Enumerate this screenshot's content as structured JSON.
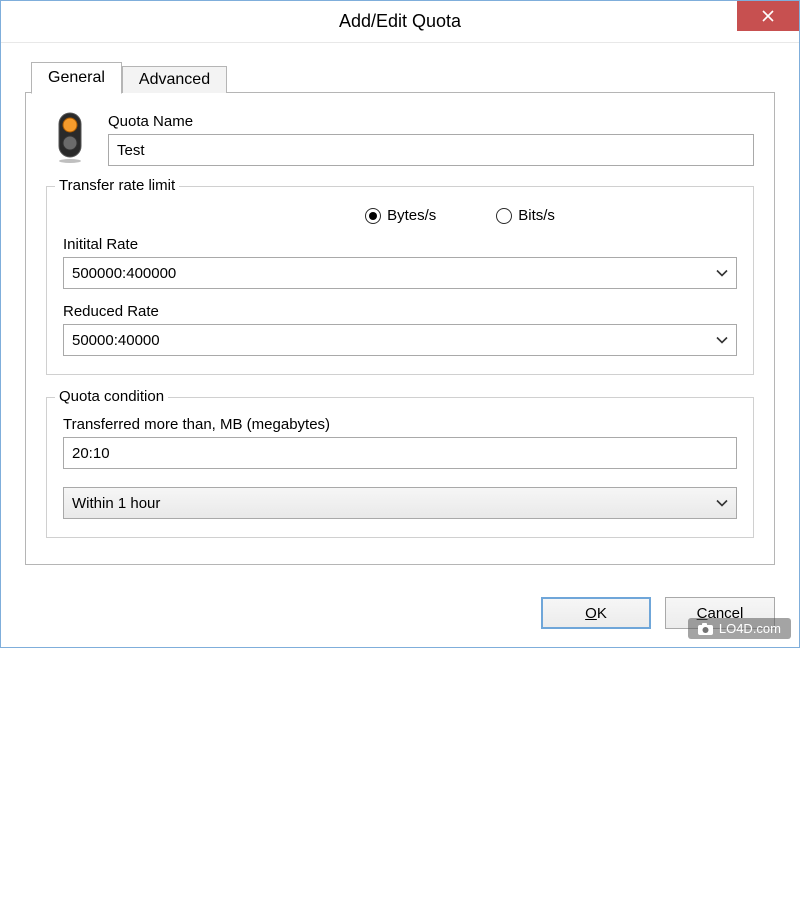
{
  "window": {
    "title": "Add/Edit Quota"
  },
  "tabs": {
    "general": "General",
    "advanced": "Advanced"
  },
  "quota": {
    "name_label": "Quota Name",
    "name_value": "Test"
  },
  "transfer_rate": {
    "legend": "Transfer rate limit",
    "unit_bytes": "Bytes/s",
    "unit_bits": "Bits/s",
    "unit_selected": "bytes",
    "initial_label": "Initital Rate",
    "initial_value": "500000:400000",
    "reduced_label": "Reduced Rate",
    "reduced_value": "50000:40000"
  },
  "quota_condition": {
    "legend": "Quota condition",
    "transferred_label": "Transferred more than, MB (megabytes)",
    "transferred_value": "20:10",
    "period_value": "Within 1 hour"
  },
  "buttons": {
    "ok_prefix": "O",
    "ok_rest": "K",
    "cancel_prefix": "C",
    "cancel_rest": "ancel"
  },
  "watermark": {
    "text": "LO4D.com"
  }
}
